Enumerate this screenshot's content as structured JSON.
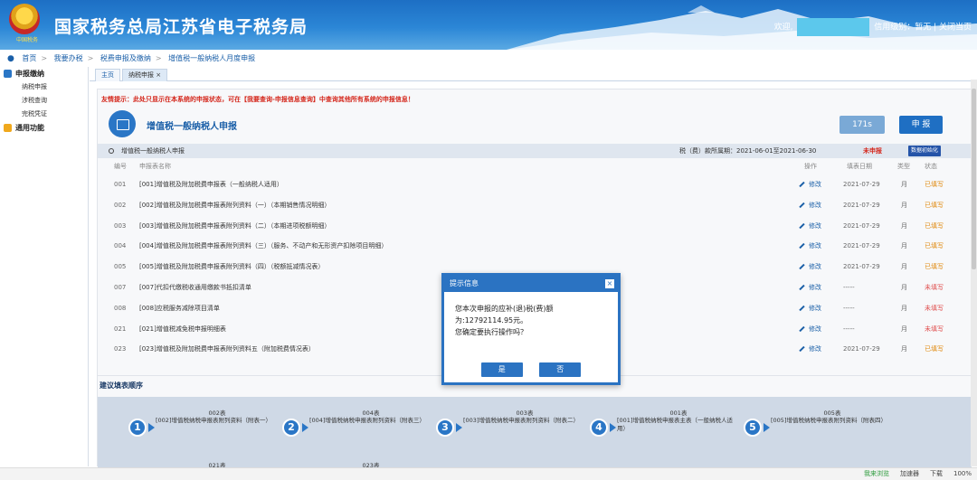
{
  "header": {
    "site_title": "国家税务总局江苏省电子税务局",
    "emblem_text": "中国税务",
    "welcome": "欢迎,",
    "credit_level": "信用级别：暂无",
    "close_link": "关闭当页",
    "colors": {
      "bar": "#2b86d6",
      "accent": "#1f6fc3"
    }
  },
  "breadcrumb": [
    "首页",
    "我要办税",
    "税费申报及缴纳",
    "增值税一般纳税人月度申报"
  ],
  "sidebar": {
    "groups": [
      {
        "label": "申报缴纳",
        "icon": "list-icon",
        "items": [
          "纳税申报",
          "涉税查询",
          "完税凭证"
        ]
      },
      {
        "label": "通用功能",
        "icon": "folder-icon",
        "items": []
      }
    ]
  },
  "tabs": [
    {
      "label": "主页"
    },
    {
      "label": "纳税申报 ×"
    }
  ],
  "main": {
    "tip": "友情提示：此处只显示在本系统的申报状态，可在【我要查询-申报信息查询】中查询其他所有系统的申报信息！",
    "title": "增值税一般纳税人申报",
    "timer": "171s",
    "declare_button": "申 报",
    "section": {
      "name": "增值税一般纳税人申报",
      "period": "税（费）款所属期：2021-06-01至2021-06-30",
      "status": "未申报",
      "init_button": "数据初始化"
    },
    "columns": {
      "no": "编号",
      "name": "申报表名称",
      "op": "操作",
      "date": "填表日期",
      "type": "类型",
      "status": "状态"
    },
    "rows": [
      {
        "no": "001",
        "name": "[001]增值税及附加税费申报表（一般纳税人适用）",
        "op": "修改",
        "date": "2021-07-29",
        "type": "月",
        "status": "已填写",
        "red": false
      },
      {
        "no": "002",
        "name": "[002]增值税及附加税费申报表附列资料（一）（本期销售情况明细）",
        "op": "修改",
        "date": "2021-07-29",
        "type": "月",
        "status": "已填写",
        "red": false
      },
      {
        "no": "003",
        "name": "[003]增值税及附加税费申报表附列资料（二）（本期进项税额明细）",
        "op": "修改",
        "date": "2021-07-29",
        "type": "月",
        "status": "已填写",
        "red": false
      },
      {
        "no": "004",
        "name": "[004]增值税及附加税费申报表附列资料（三）（服务、不动产和无形资产扣除项目明细）",
        "op": "修改",
        "date": "2021-07-29",
        "type": "月",
        "status": "已填写",
        "red": false
      },
      {
        "no": "005",
        "name": "[005]增值税及附加税费申报表附列资料（四）（税额抵减情况表）",
        "op": "修改",
        "date": "2021-07-29",
        "type": "月",
        "status": "已填写",
        "red": false
      },
      {
        "no": "007",
        "name": "[007]代扣代缴税收通用缴款书抵扣清单",
        "op": "修改",
        "date": "-----",
        "type": "月",
        "status": "未填写",
        "red": true
      },
      {
        "no": "008",
        "name": "[008]应税服务减除项目清单",
        "op": "修改",
        "date": "-----",
        "type": "月",
        "status": "未填写",
        "red": true
      },
      {
        "no": "021",
        "name": "[021]增值税减免税申报明细表",
        "op": "修改",
        "date": "-----",
        "type": "月",
        "status": "未填写",
        "red": true
      },
      {
        "no": "023",
        "name": "[023]增值税及附加税费申报表附列资料五（附加税费情况表）",
        "op": "修改",
        "date": "2021-07-29",
        "type": "月",
        "status": "已填写",
        "red": false
      }
    ],
    "order_title": "建议填表顺序",
    "steps": [
      {
        "num": "1",
        "table": "002表",
        "desc": "[002]增值税纳税申报表附列资料（附表一）"
      },
      {
        "num": "2",
        "table": "004表",
        "desc": "[004]增值税纳税申报表附列资料（附表三）"
      },
      {
        "num": "3",
        "table": "003表",
        "desc": "[003]增值税纳税申报表附列资料（附表二）"
      },
      {
        "num": "4",
        "table": "001表",
        "desc": "[001]增值税纳税申报表主表（一般纳税人适用）"
      },
      {
        "num": "5",
        "table": "005表",
        "desc": "[005]增值税纳税申报表附列资料（附表四）"
      }
    ],
    "next_row": [
      "021表",
      "023表"
    ]
  },
  "dialog": {
    "title": "提示信息",
    "message": "您本次申报的应补(退)税(费)额为:12792114.95元。",
    "question": "您确定要执行操作吗？",
    "yes": "是",
    "no": "否"
  },
  "statusbar": [
    "我来浏览",
    "加速器",
    "下载",
    "100%"
  ]
}
